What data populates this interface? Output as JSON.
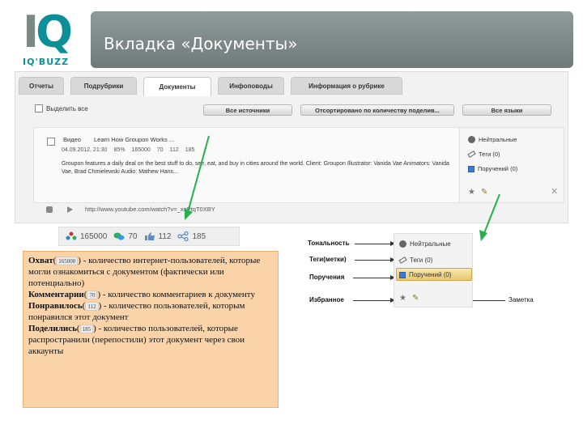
{
  "logo": {
    "letters": "IQ",
    "sub": "IQ'BUZZ"
  },
  "title": "Вкладка «Документы»",
  "tabs": [
    "Отчеты",
    "Подрубрики",
    "Документы",
    "Инфоповоды",
    "Информация о рубрике"
  ],
  "toolbar": {
    "select_all": "Выделить все",
    "sources": "Все источники",
    "sort": "Отсортировано по количеству поделив...",
    "languages": "Все языки"
  },
  "post": {
    "type": "Видео",
    "title": "Learn How Groupon Works ...",
    "date": "04.09.2012, 21:30",
    "percent": "85%",
    "reach": "165000",
    "comments": "70",
    "likes": "112",
    "shares": "185",
    "text": "Groupon features a daily deal on the best stuff to do, see, eat, and buy in cities around the world. Client: Groupon Illustrator: Vanida Vae Animators: Vanida Vae, Brad Chmielewski Audio: Mathew Hans...",
    "url": "http://www.youtube.com/watch?v=_xqPtqT0XBY"
  },
  "side_panel": {
    "tone": "Нейтральные",
    "tags": "Теги (0)",
    "assignments": "Поручений (0)"
  },
  "metrics": {
    "reach": "165000",
    "comments": "70",
    "likes": "112",
    "shares": "185"
  },
  "note": {
    "reach_label": "Охват",
    "reach_chip": "165000",
    "reach_text": " - количество интернет-пользователей, которые могли ознакомиться с документом (фактически или потенциально)",
    "comments_label": "Комментарии",
    "comments_chip": "70",
    "comments_text": " - количество комментариев к документу",
    "likes_label": "Понравилось",
    "likes_chip": "112",
    "likes_text": " - количество пользователей, которым понравился этот документ",
    "shares_label": "Поделились",
    "shares_chip": "185",
    "shares_text": " - количество пользователей, которые распространили (перепостили) этот документ через свои аккаунты"
  },
  "legend": {
    "tone_label": "Тональность",
    "tags_label": "Теги(метки)",
    "assign_label": "Поручения",
    "fav_label": "Избранное",
    "note_label": "Заметка",
    "tone_item": "Нейтральные",
    "tags_item": "Теги (0)",
    "assign_item": "Поручений (0)"
  },
  "colors": {
    "accent": "#0d8f98",
    "title_bar": "#7d8a87",
    "note_bg": "#fbd3a8",
    "arrow": "#22b14c"
  }
}
